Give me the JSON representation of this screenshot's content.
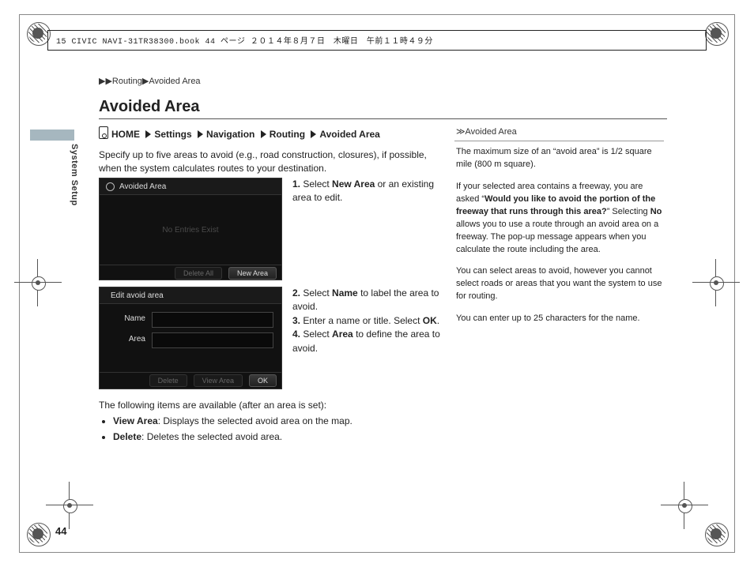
{
  "header_bar": "15 CIVIC NAVI-31TR38300.book  44 ページ  ２０１４年８月７日　木曜日　午前１１時４９分",
  "breadcrumb_top": {
    "a": "Routing",
    "b": "Avoided Area"
  },
  "title": "Avoided Area",
  "nav_path": {
    "p1": "HOME",
    "p2": "Settings",
    "p3": "Navigation",
    "p4": "Routing",
    "p5": "Avoided Area"
  },
  "side_label": "System Setup",
  "intro": "Specify up to five areas to avoid (e.g., road construction, closures), if possible, when the system calculates routes to your destination.",
  "shot1": {
    "title": "Avoided Area",
    "placeholder": "No Entries Exist",
    "btn_delete": "Delete All",
    "btn_new": "New Area"
  },
  "steps1": {
    "n1": "1.",
    "t1a": "Select ",
    "t1b": "New Area",
    "t1c": " or an existing area to edit."
  },
  "shot2": {
    "title": "Edit avoid area",
    "row_name": "Name",
    "row_area": "Area",
    "btn_delete": "Delete",
    "btn_view": "View Area",
    "btn_ok": "OK"
  },
  "steps2": {
    "n2": "2.",
    "t2a": "Select ",
    "t2b": "Name",
    "t2c": " to label the area to avoid.",
    "n3": "3.",
    "t3": "Enter a name or title. Select ",
    "t3b": "OK",
    "t3c": ".",
    "n4": "4.",
    "t4a": "Select ",
    "t4b": "Area",
    "t4c": " to define the area to avoid."
  },
  "after": {
    "lead": "The following items are available (after an area is set):",
    "i1b": "View Area",
    "i1": ": Displays the selected avoid area on the map.",
    "i2b": "Delete",
    "i2": ": Deletes the selected avoid area."
  },
  "info": {
    "head": "Avoided Area",
    "p1": "The maximum size of an “avoid area” is 1/2 square mile (800 m square).",
    "p2a": "If your selected area contains a freeway, you are asked “",
    "p2b": "Would you like to avoid the portion of the freeway that runs through this area?",
    "p2c": "” Selecting ",
    "p2d": "No",
    "p2e": " allows you to use a route through an avoid area on a freeway. The pop-up message appears when you calculate the route including the area.",
    "p3": "You can select areas to avoid, however you cannot select roads or areas that you want the system to use for routing.",
    "p4": "You can enter up to 25 characters for the name."
  },
  "page_no": "44"
}
